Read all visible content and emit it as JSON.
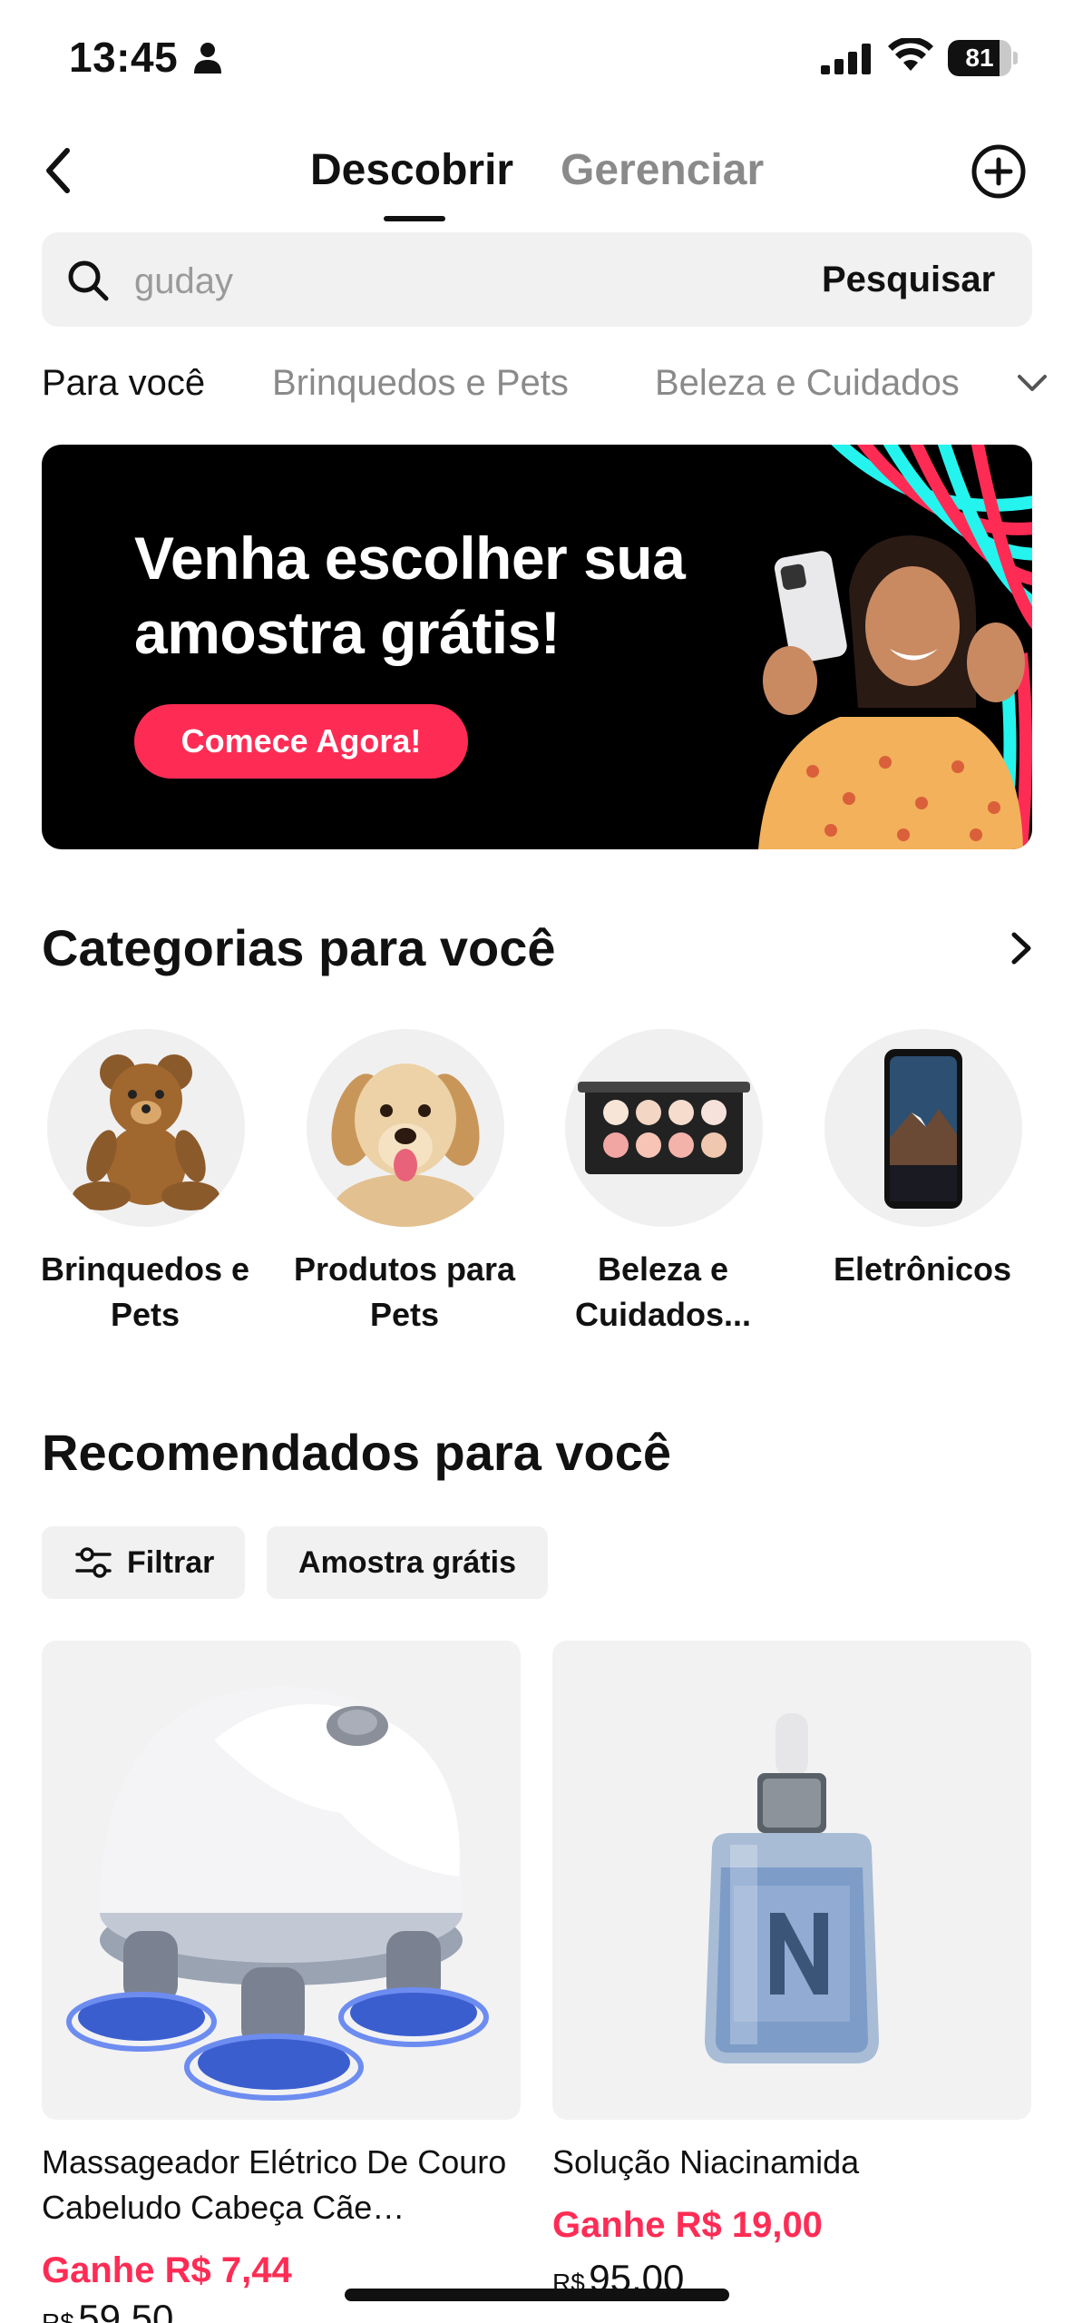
{
  "status_bar": {
    "time": "13:45",
    "battery": "81",
    "battery_level": 0.81
  },
  "nav": {
    "tab_discover": "Descobrir",
    "tab_manage": "Gerenciar"
  },
  "search": {
    "value": "",
    "placeholder": "guday",
    "button": "Pesquisar"
  },
  "category_tabs": [
    "Para você",
    "Brinquedos e Pets",
    "Beleza e Cuidados"
  ],
  "banner": {
    "headline": "Venha escolher sua amostra grátis!",
    "cta": "Comece Agora!"
  },
  "categories": {
    "title": "Categorias para você",
    "items": [
      {
        "label": "Brinquedos e Pets",
        "icon": "teddy-bear-image"
      },
      {
        "label": "Produtos para Pets",
        "icon": "dog-image"
      },
      {
        "label": "Beleza e Cuidados...",
        "icon": "makeup-palette-image"
      },
      {
        "label": "Eletrônicos",
        "icon": "smartphone-image"
      }
    ]
  },
  "recommended": {
    "title": "Recomendados para você",
    "filters": {
      "filter": "Filtrar",
      "sample": "Amostra grátis"
    },
    "products": [
      {
        "title": "Massageador Elétrico De Couro Cabeludo Cabeça Cãe…",
        "earn": "Ganhe R$ 7,44",
        "currency": "R$",
        "price": "59,50",
        "image": "scalp-massager-image"
      },
      {
        "title": "Solução Niacinamida",
        "earn": "Ganhe R$ 19,00",
        "currency": "R$",
        "price": "95,00",
        "image": "serum-bottle-image"
      }
    ]
  },
  "colors": {
    "accent": "#fe2c55",
    "text": "#111111",
    "muted": "#8a8a8a",
    "surface": "#f1f1f2"
  }
}
